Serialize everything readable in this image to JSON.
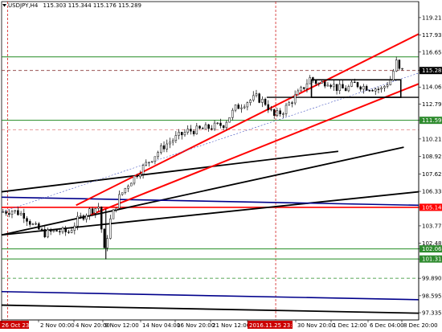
{
  "header": {
    "symbol_timeframe": "USDJPY,H4",
    "ohlc": "115.303 115.344 115.176 115.289"
  },
  "colors": {
    "background": "#ffffff",
    "candles": "#000000",
    "channel": "#ff0000",
    "green_level": "#228b22",
    "blue_line": "#00008b",
    "black_line": "#000000",
    "price_tag_red": "#ff0000",
    "price_tag_green": "#2e8b2e",
    "price_tag_black": "#000000",
    "session_separator": "#cc0000"
  },
  "price_axis": {
    "ticks": [
      "119.210",
      "117.935",
      "116.655",
      "115.289",
      "114.065",
      "112.790",
      "111.598",
      "110.215",
      "108.920",
      "107.625",
      "106.330",
      "105.148",
      "103.775",
      "102.480",
      "102.067",
      "101.318",
      "99.890",
      "98.595",
      "97.335"
    ]
  },
  "time_axis": {
    "ticks": [
      "26 Oct 23:00",
      "2 Nov 00:00",
      "4 Nov 20:00",
      "9 Nov 12:00",
      "14 Nov 04:00",
      "16 Nov 20:00",
      "21 Nov 12:00",
      "2016.11.25 23:00",
      "30 Nov 20:00",
      "1 Dec 12:00",
      "6 Dec 04:00",
      "8 Dec 20:00"
    ]
  },
  "chart_data": {
    "type": "candlestick",
    "title": "USDJPY,H4",
    "ylim": [
      96.8,
      119.8
    ],
    "x_range": [
      0,
      140
    ],
    "current_price": 115.289,
    "ohlc_last": {
      "open": 115.303,
      "high": 115.344,
      "low": 115.176,
      "close": 115.289
    },
    "trend_path": [
      [
        0,
        104.8
      ],
      [
        4,
        104.9
      ],
      [
        8,
        104.6
      ],
      [
        11,
        103.8
      ],
      [
        15,
        103.2
      ],
      [
        19,
        103.4
      ],
      [
        23,
        103.3
      ],
      [
        26,
        104.2
      ],
      [
        30,
        104.9
      ],
      [
        33,
        105.2
      ],
      [
        35,
        101.9
      ],
      [
        37,
        104.2
      ],
      [
        40,
        105.9
      ],
      [
        43,
        106.9
      ],
      [
        47,
        107.9
      ],
      [
        51,
        108.8
      ],
      [
        55,
        109.7
      ],
      [
        59,
        110.3
      ],
      [
        63,
        110.8
      ],
      [
        67,
        110.9
      ],
      [
        71,
        111.1
      ],
      [
        75,
        111.3
      ],
      [
        79,
        112.5
      ],
      [
        83,
        113.0
      ],
      [
        86,
        113.3
      ],
      [
        89,
        112.9
      ],
      [
        92,
        111.9
      ],
      [
        95,
        112.3
      ],
      [
        98,
        113.1
      ],
      [
        101,
        113.8
      ],
      [
        104,
        114.7
      ],
      [
        107,
        114.3
      ],
      [
        110,
        114.5
      ],
      [
        113,
        114.0
      ],
      [
        116,
        113.9
      ],
      [
        119,
        114.3
      ],
      [
        122,
        114.1
      ],
      [
        125,
        114.0
      ],
      [
        128,
        113.9
      ],
      [
        131,
        114.6
      ],
      [
        133,
        115.9
      ],
      [
        134,
        115.3
      ],
      [
        135,
        115.29
      ]
    ],
    "channel": {
      "upper": [
        [
          25,
          105.3
        ],
        [
          140,
          118.0
        ]
      ],
      "lower": [
        [
          30,
          104.6
        ],
        [
          140,
          114.3
        ]
      ],
      "mid": [
        [
          0,
          104.8
        ],
        [
          140,
          115.1
        ]
      ]
    },
    "horizontal_levels": [
      {
        "price": 116.3,
        "color": "green"
      },
      {
        "price": 111.598,
        "color": "green"
      },
      {
        "price": 105.148,
        "color": "red"
      },
      {
        "price": 102.067,
        "color": "green"
      },
      {
        "price": 101.318,
        "color": "green"
      },
      {
        "price": 115.289,
        "color": "dark-red"
      },
      {
        "price": 99.89,
        "color": "green-dashed"
      }
    ],
    "trendlines": [
      {
        "from": [
          0,
          106.3
        ],
        "to": [
          113,
          109.3
        ],
        "color": "black"
      },
      {
        "from": [
          0,
          103.1
        ],
        "to": [
          135,
          109.6
        ],
        "color": "black"
      },
      {
        "from": [
          0,
          103.1
        ],
        "to": [
          140,
          106.3
        ],
        "color": "black"
      },
      {
        "from": [
          0,
          105.9
        ],
        "to": [
          140,
          105.3
        ],
        "color": "blue"
      },
      {
        "from": [
          0,
          98.9
        ],
        "to": [
          140,
          98.3
        ],
        "color": "blue"
      },
      {
        "from": [
          0,
          97.9
        ],
        "to": [
          140,
          97.3
        ],
        "color": "black"
      }
    ],
    "rectangle": {
      "x": [
        104,
        134
      ],
      "price": [
        114.6,
        113.3
      ]
    },
    "separators_x": [
      2,
      92
    ]
  }
}
